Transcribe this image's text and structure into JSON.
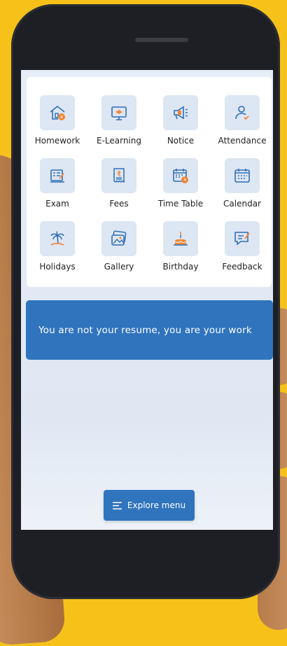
{
  "colors": {
    "accent": "#2f74bd",
    "icon_bg": "#dde6f3",
    "icon_orange": "#f0883a",
    "icon_blue": "#2f6fb8",
    "background": "#f6c21a"
  },
  "menu": {
    "items": [
      {
        "label": "Homework",
        "icon": "house-icon"
      },
      {
        "label": "E-Learning",
        "icon": "monitor-teacher-icon"
      },
      {
        "label": "Notice",
        "icon": "megaphone-icon"
      },
      {
        "label": "Attendance",
        "icon": "user-check-icon"
      },
      {
        "label": "Exam",
        "icon": "exam-paper-icon"
      },
      {
        "label": "Fees",
        "icon": "receipt-icon"
      },
      {
        "label": "Time Table",
        "icon": "calendar-clock-icon"
      },
      {
        "label": "Calendar",
        "icon": "calendar-icon"
      },
      {
        "label": "Holidays",
        "icon": "palm-tree-icon"
      },
      {
        "label": "Gallery",
        "icon": "gallery-icon"
      },
      {
        "label": "Birthday",
        "icon": "cake-icon"
      },
      {
        "label": "Feedback",
        "icon": "feedback-icon"
      }
    ]
  },
  "quote": {
    "text": "You are not your resume, you are your work"
  },
  "explore": {
    "label": "Explore menu",
    "icon": "menu-lines-icon"
  }
}
